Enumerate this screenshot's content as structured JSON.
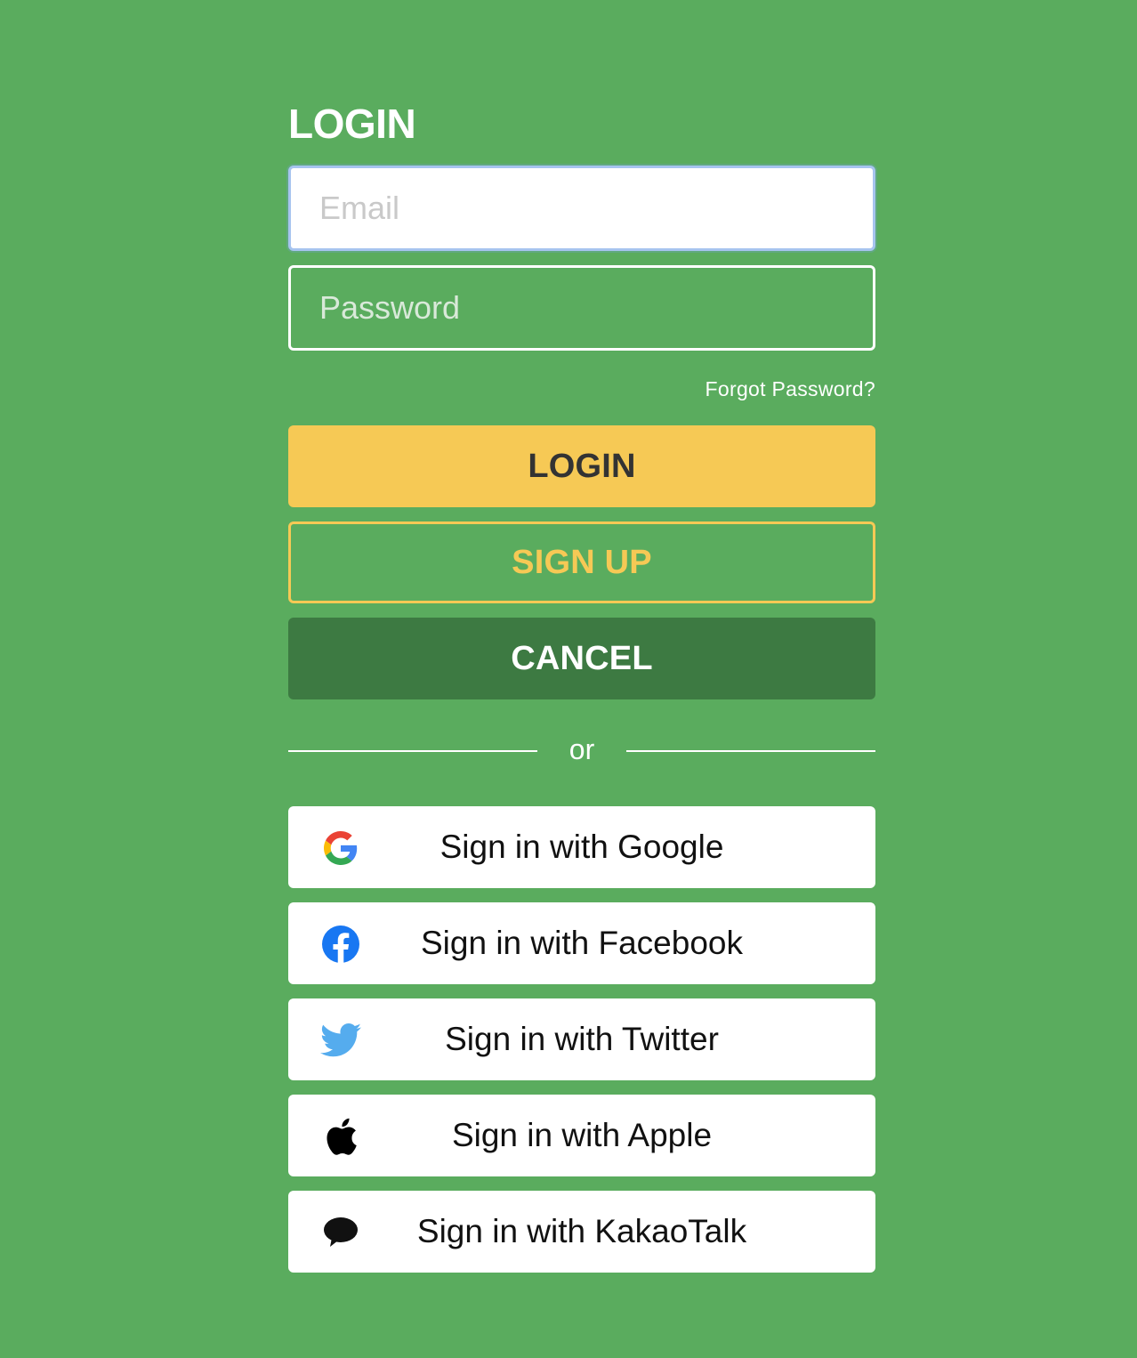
{
  "heading": "LOGIN",
  "form": {
    "email_placeholder": "Email",
    "password_placeholder": "Password",
    "forgot_password": "Forgot Password?"
  },
  "buttons": {
    "login": "LOGIN",
    "signup": "SIGN UP",
    "cancel": "CANCEL"
  },
  "divider_text": "or",
  "social": [
    {
      "label": "Sign in with Google",
      "icon": "google-icon"
    },
    {
      "label": "Sign in with Facebook",
      "icon": "facebook-icon"
    },
    {
      "label": "Sign in with Twitter",
      "icon": "twitter-icon"
    },
    {
      "label": "Sign in with Apple",
      "icon": "apple-icon"
    },
    {
      "label": "Sign in with KakaoTalk",
      "icon": "kakaotalk-icon"
    }
  ],
  "colors": {
    "background": "#5aac5e",
    "login_button": "#f6c955",
    "cancel_button": "#3d7a42",
    "social_button": "#ffffff"
  }
}
